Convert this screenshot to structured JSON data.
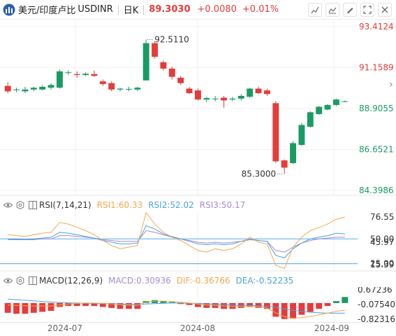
{
  "header": {
    "title": "美元/印度卢比",
    "symbol": "USDINR",
    "period": "日K",
    "price": "89.3030",
    "change": "+0.0080",
    "change_pct": "+0.01%",
    "tools": [
      "crosshair-icon",
      "indicator-icon",
      "draw-icon",
      "fullscreen-icon",
      "close-icon"
    ]
  },
  "colors": {
    "up": "#e53b3b",
    "down": "#1a9b63",
    "rsi1": "#f5a94c",
    "rsi2": "#4aa3df",
    "rsi3": "#a78bd3",
    "dif": "#f5a94c",
    "dea": "#4aa3df",
    "ref_line": "#6cb6f0"
  },
  "price_axis": {
    "labels": [
      "93.4124",
      "91.1589",
      "88.9055",
      "86.6521",
      "84.3986"
    ],
    "min": 84.3986,
    "max": 93.4124
  },
  "annotations": {
    "high": "92.5110",
    "low": "85.3000"
  },
  "x_axis": {
    "labels": [
      "2024-07",
      "2024-08",
      "2024-09"
    ]
  },
  "rsi": {
    "name": "RSI(7,14,21)",
    "rsi1_label": "RSI1:60.33",
    "rsi2_label": "RSI2:52.02",
    "rsi3_label": "RSI3:50.17",
    "axis_labels": [
      "76.55",
      "50.00",
      "45.97",
      "25.00",
      "15.39"
    ]
  },
  "macd": {
    "name": "MACD(12,26,9)",
    "macd_label": "MACD:0.30936",
    "dif_label": "DIF:-0.36766",
    "dea_label": "DEA:-0.52235",
    "axis_labels": [
      "0.67236",
      "-0.07540",
      "-0.82316"
    ]
  },
  "chart_data": {
    "type": "candlestick",
    "candles": [
      {
        "o": 90.15,
        "h": 90.35,
        "l": 89.75,
        "c": 89.85
      },
      {
        "o": 89.95,
        "h": 90.05,
        "l": 89.8,
        "c": 89.95
      },
      {
        "o": 89.85,
        "h": 90.1,
        "l": 89.75,
        "c": 89.95
      },
      {
        "o": 89.95,
        "h": 90.1,
        "l": 89.85,
        "c": 90.05
      },
      {
        "o": 89.95,
        "h": 90.2,
        "l": 89.9,
        "c": 90.1
      },
      {
        "o": 90.05,
        "h": 90.3,
        "l": 89.95,
        "c": 90.2
      },
      {
        "o": 90.05,
        "h": 91.05,
        "l": 90.0,
        "c": 90.95
      },
      {
        "o": 90.9,
        "h": 91.0,
        "l": 90.75,
        "c": 90.9
      },
      {
        "o": 90.8,
        "h": 90.95,
        "l": 90.6,
        "c": 90.75
      },
      {
        "o": 90.75,
        "h": 90.9,
        "l": 90.7,
        "c": 90.82
      },
      {
        "o": 90.8,
        "h": 91.0,
        "l": 90.65,
        "c": 90.7
      },
      {
        "o": 90.4,
        "h": 90.5,
        "l": 90.15,
        "c": 90.25
      },
      {
        "o": 90.3,
        "h": 90.4,
        "l": 89.85,
        "c": 89.95
      },
      {
        "o": 89.95,
        "h": 90.05,
        "l": 89.85,
        "c": 90.0
      },
      {
        "o": 89.95,
        "h": 90.1,
        "l": 89.85,
        "c": 89.98
      },
      {
        "o": 89.95,
        "h": 90.1,
        "l": 89.85,
        "c": 90.05
      },
      {
        "o": 90.45,
        "h": 92.7,
        "l": 90.45,
        "c": 92.5
      },
      {
        "o": 92.5,
        "h": 92.6,
        "l": 91.65,
        "c": 91.75
      },
      {
        "o": 91.45,
        "h": 91.55,
        "l": 91.0,
        "c": 91.1
      },
      {
        "o": 91.1,
        "h": 91.2,
        "l": 90.5,
        "c": 90.65
      },
      {
        "o": 90.6,
        "h": 90.7,
        "l": 90.2,
        "c": 90.3
      },
      {
        "o": 90.0,
        "h": 90.1,
        "l": 89.7,
        "c": 89.75
      },
      {
        "o": 89.9,
        "h": 90.0,
        "l": 89.35,
        "c": 89.4
      },
      {
        "o": 89.4,
        "h": 89.55,
        "l": 89.25,
        "c": 89.48
      },
      {
        "o": 89.45,
        "h": 89.6,
        "l": 89.3,
        "c": 89.45
      },
      {
        "o": 89.5,
        "h": 89.6,
        "l": 88.95,
        "c": 89.35
      },
      {
        "o": 89.4,
        "h": 89.55,
        "l": 89.3,
        "c": 89.45
      },
      {
        "o": 89.45,
        "h": 89.7,
        "l": 89.35,
        "c": 89.6
      },
      {
        "o": 89.55,
        "h": 90.05,
        "l": 89.5,
        "c": 90.0
      },
      {
        "o": 90.0,
        "h": 90.1,
        "l": 89.7,
        "c": 89.75
      },
      {
        "o": 89.9,
        "h": 90.0,
        "l": 89.6,
        "c": 89.7
      },
      {
        "o": 89.2,
        "h": 89.3,
        "l": 85.9,
        "c": 86.0
      },
      {
        "o": 86.05,
        "h": 86.1,
        "l": 85.3,
        "c": 85.65
      },
      {
        "o": 85.9,
        "h": 87.1,
        "l": 85.85,
        "c": 87.0
      },
      {
        "o": 86.9,
        "h": 88.1,
        "l": 86.85,
        "c": 88.0
      },
      {
        "o": 87.9,
        "h": 88.75,
        "l": 87.85,
        "c": 88.7
      },
      {
        "o": 88.6,
        "h": 89.05,
        "l": 88.55,
        "c": 89.0
      },
      {
        "o": 88.85,
        "h": 89.15,
        "l": 88.8,
        "c": 89.1
      },
      {
        "o": 89.1,
        "h": 89.45,
        "l": 89.05,
        "c": 89.4
      },
      {
        "o": 89.3,
        "h": 89.35,
        "l": 89.25,
        "c": 89.303
      }
    ],
    "rsi1": [
      55,
      54,
      53,
      55,
      57,
      58,
      70,
      68,
      64,
      60,
      55,
      48,
      42,
      38,
      40,
      42,
      82,
      68,
      58,
      52,
      48,
      42,
      36,
      34,
      38,
      36,
      38,
      44,
      52,
      46,
      44,
      18,
      14,
      40,
      52,
      60,
      64,
      68,
      74,
      76.55
    ],
    "rsi2": [
      50,
      50,
      49,
      50,
      51,
      52,
      58,
      57,
      55,
      53,
      51,
      48,
      46,
      44,
      44,
      45,
      66,
      62,
      56,
      53,
      50,
      47,
      44,
      43,
      44,
      43,
      44,
      47,
      50,
      48,
      47,
      30,
      27,
      38,
      45,
      50,
      52,
      54,
      57,
      56
    ],
    "rsi3": [
      49,
      49,
      49,
      49,
      50,
      50,
      54,
      54,
      53,
      52,
      51,
      49,
      48,
      47,
      47,
      47,
      60,
      58,
      55,
      52,
      50,
      48,
      46,
      45,
      46,
      45,
      46,
      47,
      49,
      48,
      47,
      36,
      34,
      40,
      45,
      48,
      50,
      51,
      52,
      52
    ],
    "macd_hist": [
      -0.5,
      -0.55,
      -0.55,
      -0.5,
      -0.45,
      -0.4,
      -0.2,
      -0.15,
      -0.15,
      -0.15,
      -0.15,
      -0.2,
      -0.25,
      -0.3,
      -0.3,
      -0.3,
      0.1,
      0.15,
      0.1,
      0.05,
      -0.05,
      -0.1,
      -0.2,
      -0.25,
      -0.25,
      -0.3,
      -0.3,
      -0.25,
      -0.2,
      -0.25,
      -0.3,
      -0.7,
      -0.82,
      -0.8,
      -0.6,
      -0.45,
      -0.3,
      -0.15,
      0.1,
      0.31
    ],
    "dif": [
      -0.1,
      -0.12,
      -0.14,
      -0.15,
      -0.15,
      -0.15,
      -0.1,
      -0.05,
      -0.02,
      0.0,
      0.0,
      -0.02,
      -0.05,
      -0.08,
      -0.1,
      -0.12,
      0.05,
      0.1,
      0.1,
      0.08,
      0.04,
      -0.0,
      -0.05,
      -0.1,
      -0.12,
      -0.15,
      -0.17,
      -0.18,
      -0.17,
      -0.2,
      -0.25,
      -0.5,
      -0.7,
      -0.78,
      -0.75,
      -0.68,
      -0.6,
      -0.52,
      -0.42,
      -0.37
    ],
    "dea": [
      0.2,
      0.17,
      0.14,
      0.11,
      0.08,
      0.05,
      0.03,
      0.01,
      0.0,
      -0.01,
      -0.02,
      -0.03,
      -0.04,
      -0.05,
      -0.06,
      -0.07,
      -0.05,
      -0.03,
      -0.01,
      0.0,
      0.0,
      -0.01,
      -0.02,
      -0.04,
      -0.06,
      -0.08,
      -0.1,
      -0.11,
      -0.12,
      -0.14,
      -0.16,
      -0.22,
      -0.3,
      -0.37,
      -0.43,
      -0.47,
      -0.5,
      -0.52,
      -0.52,
      -0.52
    ]
  }
}
